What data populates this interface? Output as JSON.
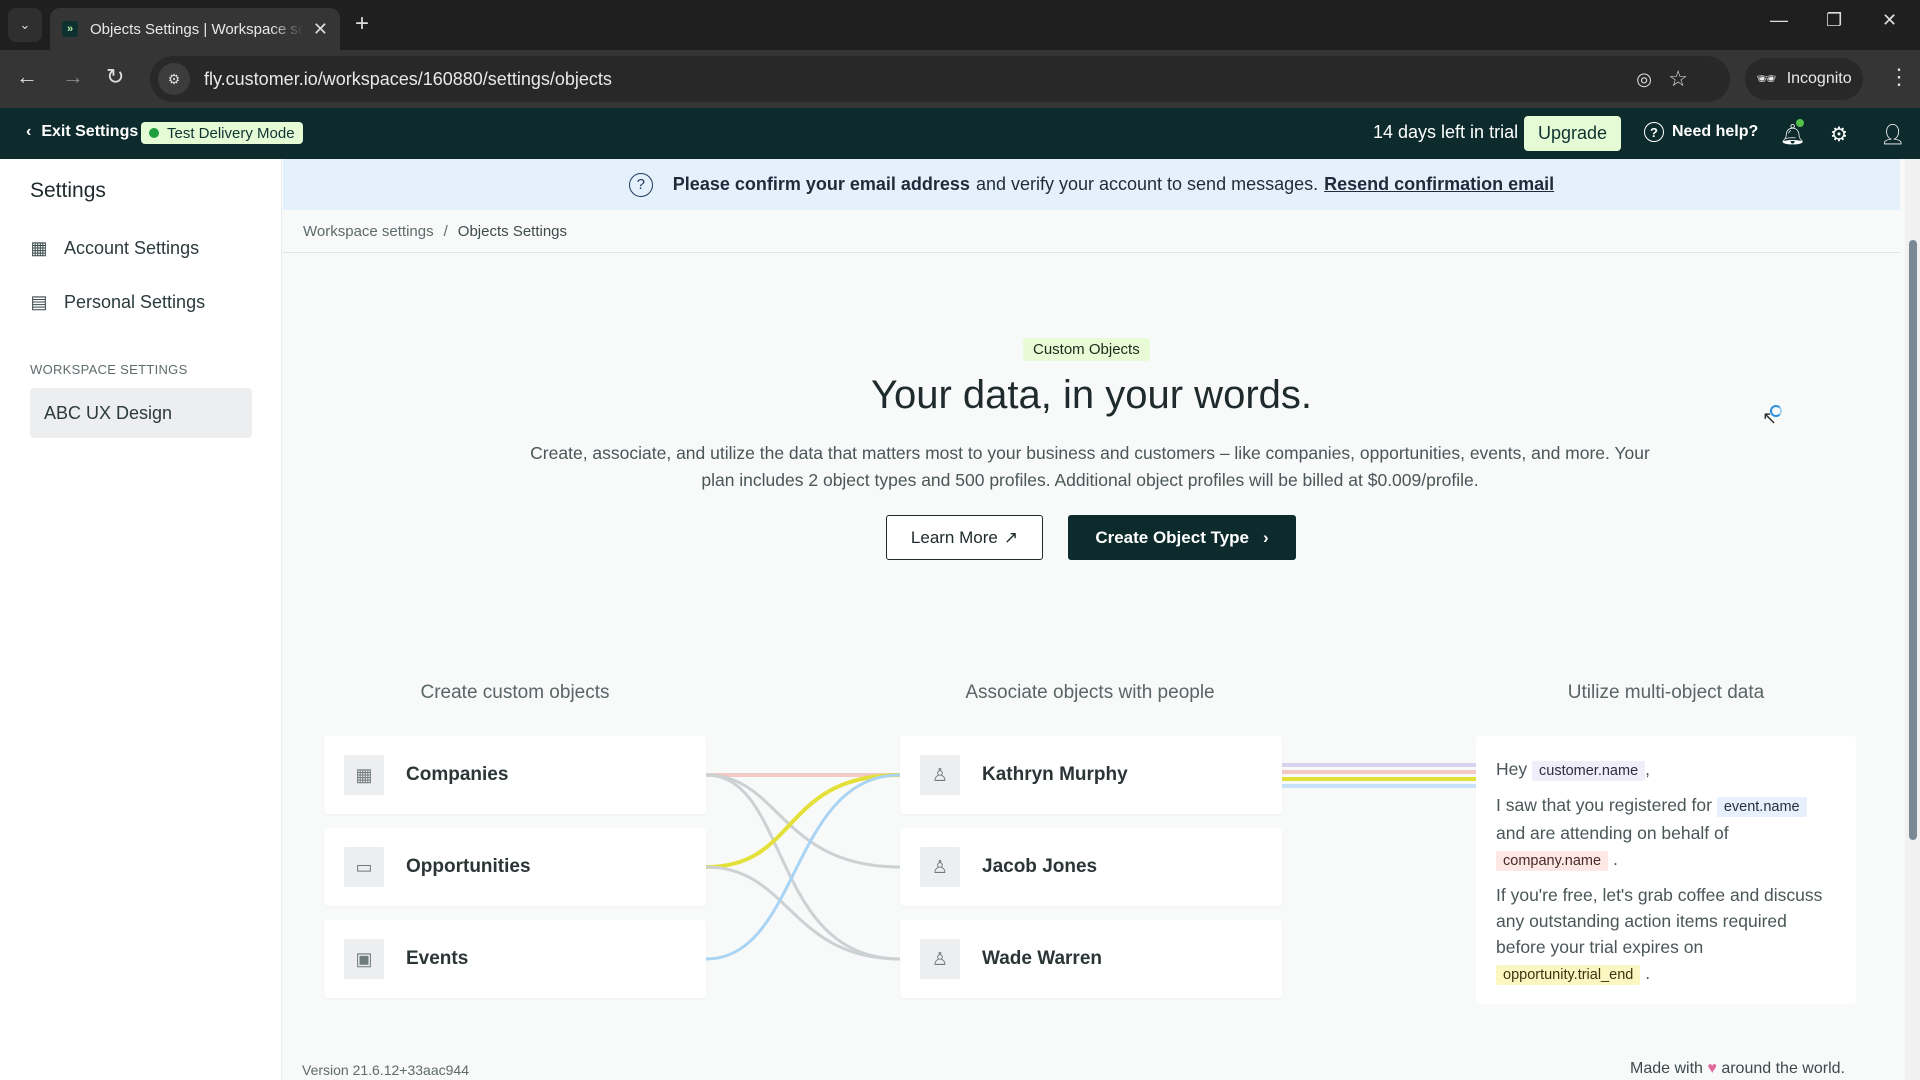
{
  "browser": {
    "tab_title": "Objects Settings | Workspace settings",
    "url": "fly.customer.io/workspaces/160880/settings/objects",
    "incognito_label": "Incognito"
  },
  "header": {
    "exit_label": "Exit Settings",
    "test_mode_label": "Test Delivery Mode",
    "trial_text": "14 days left in trial",
    "upgrade_label": "Upgrade",
    "help_label": "Need help?",
    "notification_dot_color": "#52c14b"
  },
  "sidebar": {
    "title": "Settings",
    "items": [
      {
        "label": "Account Settings",
        "icon": "building-icon"
      },
      {
        "label": "Personal Settings",
        "icon": "personal-settings-icon"
      }
    ],
    "section_label": "WORKSPACE SETTINGS",
    "workspace_item": "ABC UX Design"
  },
  "banner": {
    "bold_text": "Please confirm your email address",
    "text": "and verify your account to send messages.",
    "link": "Resend confirmation email"
  },
  "breadcrumb": {
    "parent": "Workspace settings",
    "separator": "/",
    "current": "Objects Settings"
  },
  "hero": {
    "pill": "Custom Objects",
    "headline": "Your data, in your words.",
    "description": "Create, associate, and utilize the data that matters most to your business and customers – like companies, opportunities, events, and more. Your plan includes 2 object types and 500 profiles. Additional object profiles will be billed at $0.009/profile.",
    "learn_more": "Learn More",
    "create_button": "Create Object Type"
  },
  "columns": {
    "create_heading": "Create custom objects",
    "associate_heading": "Associate objects with people",
    "utilize_heading": "Utilize multi-object data",
    "objects": [
      {
        "label": "Companies",
        "icon": "building-icon",
        "color": "#f3c9c6"
      },
      {
        "label": "Opportunities",
        "icon": "id-card-icon",
        "color": "#e4e03a"
      },
      {
        "label": "Events",
        "icon": "calendar-icon",
        "color": "#a9d4f3"
      }
    ],
    "people": [
      {
        "label": "Kathryn Murphy"
      },
      {
        "label": "Jacob Jones"
      },
      {
        "label": "Wade Warren"
      }
    ],
    "message": {
      "hey": "Hey",
      "token_customer": "customer.name",
      "comma": ",",
      "line2": "I saw that you registered for",
      "token_event": "event.name",
      "line3": "and are attending on behalf of",
      "token_company": "company.name",
      "period": ".",
      "line4": "If you're free, let's grab coffee and discuss any outstanding action items required before your trial expires on",
      "token_opportunity": "opportunity.trial_end"
    }
  },
  "footer": {
    "version": "Version 21.6.12+33aac944",
    "made_with_prefix": "Made with",
    "made_with_suffix": "around the world."
  }
}
